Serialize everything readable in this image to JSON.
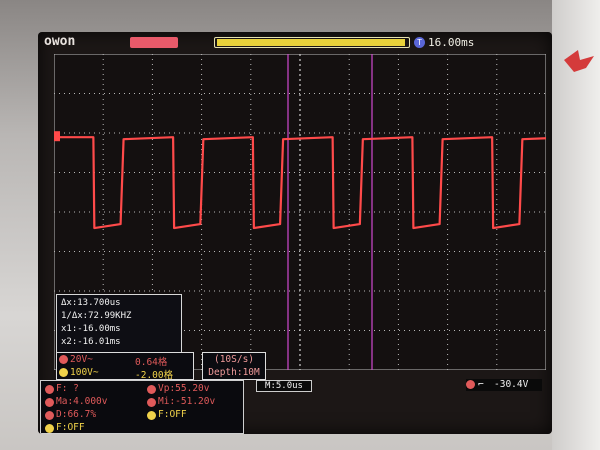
{
  "header": {
    "brand": "owon",
    "delay": "16.00ms"
  },
  "cursor_panel": {
    "delta": "Δx:13.700us",
    "inverse": "1/Δx:72.99KHZ",
    "x1": "x1:-16.00ms",
    "x2": "x2:-16.01ms"
  },
  "channels": [
    {
      "volts": "20V~",
      "offset": "0.64格",
      "color": "#e05a5a"
    },
    {
      "volts": "100V~",
      "offset": "-2.00格",
      "color": "#f0d24a"
    }
  ],
  "acquisition": {
    "rate": "(10S/s)",
    "depth": "Depth:10M"
  },
  "timebase": "M:5.0us",
  "trigger": {
    "value": "-30.4V",
    "color": "#e05a5a"
  },
  "measurements": [
    {
      "text": "F: ?",
      "color": "#e05a5a"
    },
    {
      "text": "Vp:55.20v",
      "color": "#e05a5a"
    },
    {
      "text": "Ma:4.000v",
      "color": "#e05a5a"
    },
    {
      "text": "Mi:-51.20v",
      "color": "#e05a5a"
    },
    {
      "text": "D:66.7%",
      "color": "#e05a5a"
    },
    {
      "text": "F:OFF",
      "color": "#f0d24a"
    },
    {
      "text": "F:OFF",
      "color": "#f0d24a"
    }
  ],
  "waveform": {
    "color": "#ff4a4a",
    "cursor_color": "#d04ad0",
    "high_level_div": 2.4,
    "low_level_div": 1.2,
    "duty": 0.667,
    "period_div": 2.76
  }
}
